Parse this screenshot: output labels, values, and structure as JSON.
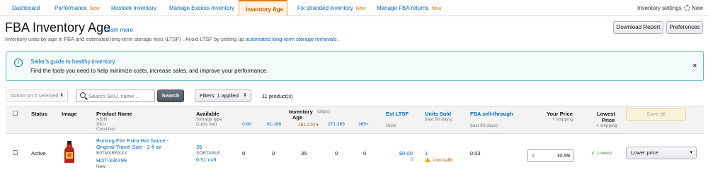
{
  "tabs": [
    {
      "label": "Dashboard",
      "badge": ""
    },
    {
      "label": "Performance",
      "badge": "New"
    },
    {
      "label": "Restock Inventory",
      "badge": ""
    },
    {
      "label": "Manage Excess Inventory",
      "badge": ""
    },
    {
      "label": "Inventory Age",
      "badge": ""
    },
    {
      "label": "Fix stranded inventory",
      "badge": "New"
    },
    {
      "label": "Manage FBA returns",
      "badge": "New"
    }
  ],
  "active_tab": "Inventory Age",
  "inventory_settings": {
    "label": "Inventory settings",
    "badge": "New"
  },
  "header": {
    "title": "FBA Inventory Age",
    "learn_more": "Learn more",
    "subtitle_prefix": "Inventory units by age in FBA and estimated long-term storage fees (LTSF) . Avoid LTSF by setting up",
    "subtitle_link": "automated long-term storage removals",
    "subtitle_suffix": ".",
    "download_report": "Download Report",
    "preferences": "Preferences"
  },
  "banner": {
    "title": "Seller's guide to healthy inventory",
    "text": "Find the tools you need to help minimize costs, increase sales, and improve your performance.",
    "close": "×"
  },
  "toolbar": {
    "action_label": "Action on 0 selected",
    "search_placeholder": "Search SKU, name ...",
    "search_button": "Search",
    "filters_label": "Filters: 1 applied",
    "product_count": "11 product(s)"
  },
  "table": {
    "headers": {
      "status": "Status",
      "image": "Image",
      "product_name": "Product Name",
      "asin": "ASIN",
      "sku": "SKU",
      "condition": "Condition",
      "available": "Available",
      "storage_type": "Storage type",
      "cubic_feet": "Cubic feet",
      "inventory": "Inventory",
      "age": "Age",
      "days": "(days)",
      "age_ranges": [
        "0-90",
        "91-180",
        "181-270",
        "271-365",
        "365+"
      ],
      "est_ltsf": "Est LTSF",
      "units": "Units",
      "units_sold": "Units Sold",
      "last_90": "(last 90 days)",
      "sell_through": "FBA sell-through",
      "sell_through_sub": "(last 90 days)",
      "your_price": "Your Price",
      "plus_shipping": "+ shipping",
      "lowest": "Lowest",
      "price": "Price",
      "lowest_shipping": "+ shipping",
      "save_all": "Save all"
    },
    "rows": [
      {
        "status": "Active",
        "name_line1": "Burning Fire Extra Hot Sauce -",
        "name_line2": "Original Travel Size - 2 fl oz",
        "asin": "B07MXRRXXX",
        "sku": "HOT-336799",
        "condition": "New",
        "available": "35",
        "storage_type": "SORTABLE",
        "cubic_feet": "0.51 cuft",
        "age_values": [
          "0",
          "0",
          "35",
          "0",
          "0"
        ],
        "est_ltsf": "$0.00",
        "est_units": "0",
        "units_sold": "1",
        "traffic": "Low traffic",
        "sell_through": "0.03",
        "currency": "$",
        "price": "10.99",
        "lowest": "Lowest",
        "action": "Lower price"
      }
    ]
  },
  "colors": {
    "link": "#0066c0",
    "accent": "#e47911",
    "banner_border": "#5bb8c4"
  }
}
